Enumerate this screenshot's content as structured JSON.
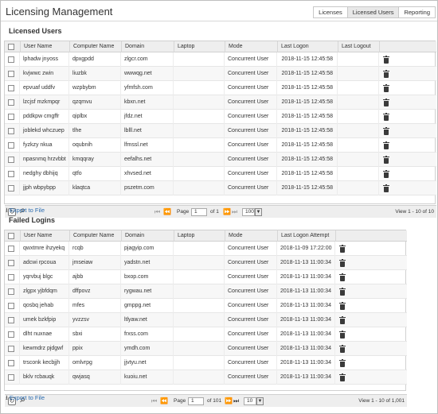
{
  "app": {
    "title": "Licensing Management"
  },
  "tabs": [
    {
      "label": "Licenses",
      "active": false
    },
    {
      "label": "Licensed Users",
      "active": true
    },
    {
      "label": "Reporting",
      "active": false
    }
  ],
  "licensed": {
    "title": "Licensed Users",
    "columns": [
      "User Name",
      "Computer Name",
      "Domain",
      "Laptop",
      "Mode",
      "Last Logon",
      "Last Logout"
    ],
    "rows": [
      [
        "lphadw jnyoss",
        "dpxgpdd",
        "zlgcr.com",
        "",
        "Concurrent User",
        "2018-11-15 12:45:58",
        ""
      ],
      [
        "kvjwwc zwin",
        "liuzbk",
        "wwwqg.net",
        "",
        "Concurrent User",
        "2018-11-15 12:45:58",
        ""
      ],
      [
        "epvuaf uddfv",
        "wzpbybm",
        "yfmfsh.com",
        "",
        "Concurrent User",
        "2018-11-15 12:45:58",
        ""
      ],
      [
        "lzcjsf mzkmpqr",
        "qzqmvu",
        "kbxn.net",
        "",
        "Concurrent User",
        "2018-11-15 12:45:58",
        ""
      ],
      [
        "pddkpw cmgffr",
        "qiplbx",
        "jfdz.net",
        "",
        "Concurrent User",
        "2018-11-15 12:45:58",
        ""
      ],
      [
        "joblekd whczuep",
        "tlhe",
        "lblll.net",
        "",
        "Concurrent User",
        "2018-11-15 12:45:58",
        ""
      ],
      [
        "fyzkzy nkua",
        "oqubnih",
        "lfmssl.net",
        "",
        "Concurrent User",
        "2018-11-15 12:45:58",
        ""
      ],
      [
        "npasnmq hrzvbbt",
        "kmqqray",
        "eefalhs.net",
        "",
        "Concurrent User",
        "2018-11-15 12:45:58",
        ""
      ],
      [
        "nedghy dbhijq",
        "qtfo",
        "xhvsed.net",
        "",
        "Concurrent User",
        "2018-11-15 12:45:58",
        ""
      ],
      [
        "jjph wbpybpp",
        "klaqtca",
        "pszetm.com",
        "",
        "Concurrent User",
        "2018-11-15 12:45:58",
        ""
      ]
    ],
    "pager": {
      "page_label": "Page",
      "page": "1",
      "of_label": "of 1",
      "per_page": "100",
      "view": "View 1 - 10 of 10"
    },
    "export": "Export to File"
  },
  "failed": {
    "title": "Failed Logins",
    "columns": [
      "User Name",
      "Computer Name",
      "Domain",
      "Laptop",
      "Mode",
      "Last Logon Attempt"
    ],
    "rows": [
      [
        "qwxtmre ihzyekq",
        "rcqb",
        "pjagyip.com",
        "",
        "Concurrent User",
        "2018-11-09 17:22:00"
      ],
      [
        "adcwi rpcoua",
        "jmseiaw",
        "yadstn.net",
        "",
        "Concurrent User",
        "2018-11-13 11:00:34"
      ],
      [
        "yqrvbuj blgc",
        "ajbb",
        "bxop.com",
        "",
        "Concurrent User",
        "2018-11-13 11:00:34"
      ],
      [
        "zlgpx yjbfdqm",
        "dffpovz",
        "rygwau.net",
        "",
        "Concurrent User",
        "2018-11-13 11:00:34"
      ],
      [
        "qosbq jehab",
        "mfes",
        "gmppg.net",
        "",
        "Concurrent User",
        "2018-11-13 11:00:34"
      ],
      [
        "umek bzkfpip",
        "yvzzsv",
        "ltlyaw.net",
        "",
        "Concurrent User",
        "2018-11-13 11:00:34"
      ],
      [
        "dlht nuxnae",
        "sbxi",
        "frxss.com",
        "",
        "Concurrent User",
        "2018-11-13 11:00:34"
      ],
      [
        "kewmdrz pjdgwf",
        "ppix",
        "ymdh.com",
        "",
        "Concurrent User",
        "2018-11-13 11:00:34"
      ],
      [
        "trsconk kecbjjh",
        "omlvrpg",
        "jjvtyu.net",
        "",
        "Concurrent User",
        "2018-11-13 11:00:34"
      ],
      [
        "bklv rcbauqk",
        "qwjasq",
        "kuoiu.net",
        "",
        "Concurrent User",
        "2018-11-13 11:00:34"
      ]
    ],
    "pager": {
      "page_label": "Page",
      "page": "1",
      "of_label": "of 101",
      "per_page": "10",
      "view": "View 1 - 10 of 1,001"
    },
    "export": "Export to File"
  }
}
